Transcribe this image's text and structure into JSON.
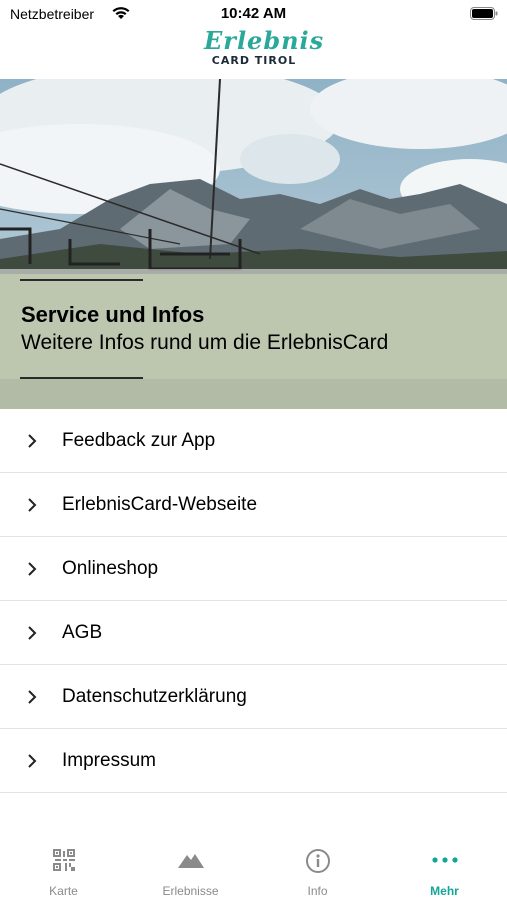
{
  "status_bar": {
    "carrier": "Netzbetreiber",
    "time": "10:42 AM"
  },
  "logo": {
    "script_text": "Erlebnis",
    "sub_text": "CARD TIROL"
  },
  "hero": {
    "title": "Service und Infos",
    "subtitle": "Weitere Infos rund um die ErlebnisCard"
  },
  "menu": {
    "items": [
      {
        "label": "Feedback zur App"
      },
      {
        "label": "ErlebnisCard-Webseite"
      },
      {
        "label": "Onlineshop"
      },
      {
        "label": "AGB"
      },
      {
        "label": "Datenschutzerklärung"
      },
      {
        "label": "Impressum"
      }
    ]
  },
  "tabs": [
    {
      "label": "Karte",
      "icon": "qr-code-icon"
    },
    {
      "label": "Erlebnisse",
      "icon": "mountain-icon"
    },
    {
      "label": "Info",
      "icon": "info-icon"
    },
    {
      "label": "Mehr",
      "icon": "more-dots-icon"
    }
  ],
  "colors": {
    "accent": "#13a596",
    "logo_teal": "#2aa89a",
    "logo_dark": "#1d2b39",
    "inactive_tab": "#8a8a8a"
  }
}
